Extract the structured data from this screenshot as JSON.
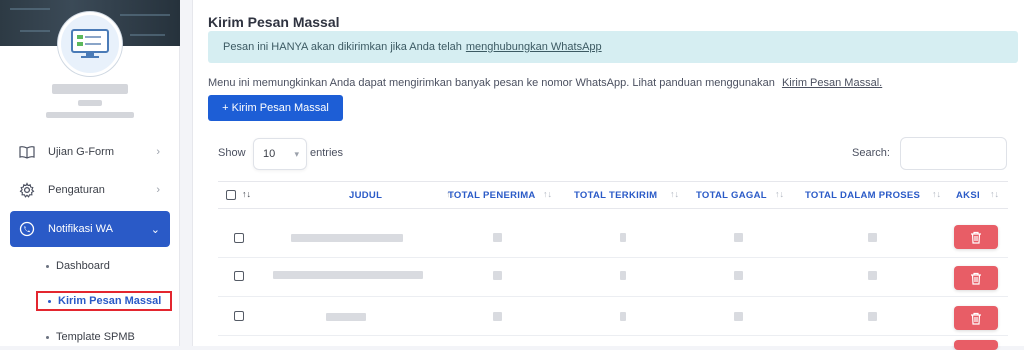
{
  "sidebar": {
    "items": [
      {
        "label": "Ujian G-Form",
        "icon": "book-icon"
      },
      {
        "label": "Pengaturan",
        "icon": "gear-icon"
      },
      {
        "label": "Notifikasi WA",
        "icon": "whatsapp-phone-icon"
      }
    ],
    "submenu": [
      {
        "label": "Dashboard"
      },
      {
        "label": "Kirim Pesan Massal"
      },
      {
        "label": "Template SPMB"
      }
    ]
  },
  "main": {
    "title": "Kirim Pesan Massal",
    "alert_text": "Pesan ini HANYA akan dikirimkan jika Anda telah",
    "alert_link": "menghubungkan WhatsApp",
    "description": "Menu ini memungkinkan Anda dapat mengirimkan banyak pesan ke nomor WhatsApp. Lihat panduan menggunakan",
    "description_link": "Kirim Pesan Massal.",
    "add_button": "+ Kirim Pesan Massal",
    "show_label": "Show",
    "entries_value": "10",
    "entries_label": "entries",
    "search_label": "Search:"
  },
  "table": {
    "sort_indicator": "↑↓",
    "columns": [
      "JUDUL",
      "TOTAL PENERIMA",
      "TOTAL TERKIRIM",
      "TOTAL GAGAL",
      "TOTAL DALAM PROSES",
      "AKSI"
    ]
  },
  "colors": {
    "primary": "#1d5ed6",
    "active_menu": "#2a5ac7",
    "alert_bg": "#d6eef2",
    "delete_button": "#e85d66",
    "highlight_border": "#e3262f"
  }
}
